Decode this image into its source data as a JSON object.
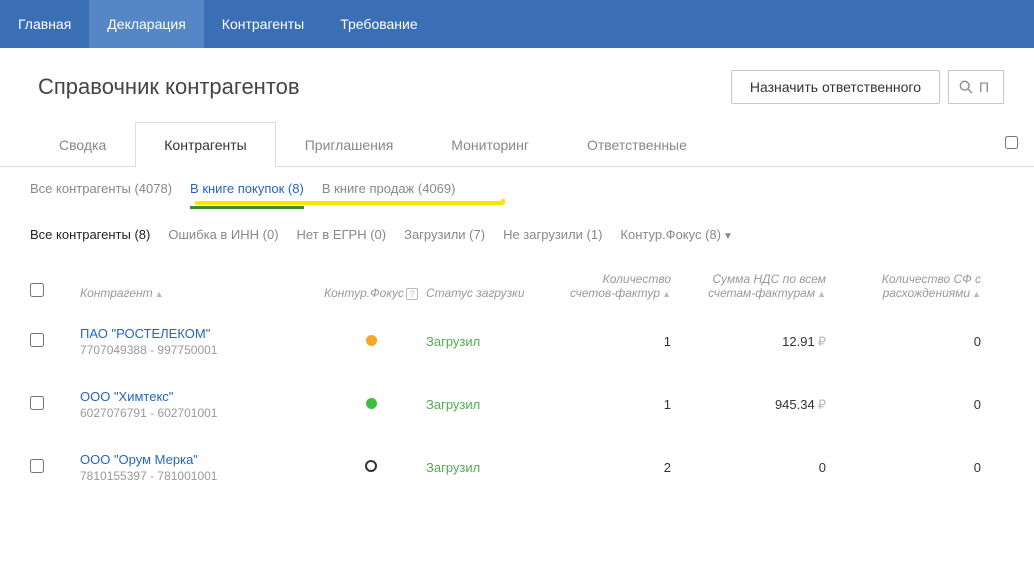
{
  "topnav": [
    {
      "label": "Главная",
      "active": false
    },
    {
      "label": "Декларация",
      "active": true
    },
    {
      "label": "Контрагенты",
      "active": false
    },
    {
      "label": "Требование",
      "active": false
    }
  ],
  "page_title": "Справочник контрагентов",
  "header_button": "Назначить ответственного",
  "search_placeholder": "П",
  "tabs": [
    {
      "label": "Сводка",
      "active": false
    },
    {
      "label": "Контрагенты",
      "active": true
    },
    {
      "label": "Приглашения",
      "active": false
    },
    {
      "label": "Мониторинг",
      "active": false
    },
    {
      "label": "Ответственные",
      "active": false
    }
  ],
  "subtabs": [
    {
      "label": "Все контрагенты (4078)",
      "selected": false
    },
    {
      "label": "В книге покупок (8)",
      "selected": true
    },
    {
      "label": "В книге продаж (4069)",
      "selected": false
    }
  ],
  "filters": [
    {
      "label": "Все контрагенты (8)",
      "active": true
    },
    {
      "label": "Ошибка в ИНН (0)",
      "active": false
    },
    {
      "label": "Нет в ЕГРН (0)",
      "active": false
    },
    {
      "label": "Загрузили (7)",
      "active": false
    },
    {
      "label": "Не загрузили (1)",
      "active": false
    },
    {
      "label": "Контур.Фокус (8)",
      "active": false,
      "dropdown": true
    }
  ],
  "columns": {
    "name": "Контрагент",
    "focus": "Контур.Фокус",
    "status": "Статус загрузки",
    "cnt": "Количество счетов-фактур",
    "sum": "Сумма НДС по всем счетам-фактурам",
    "disc": "Количество СФ с расхождениями"
  },
  "rows": [
    {
      "name": "ПАО \"РОСТЕЛЕКОМ\"",
      "sub": "7707049388 - 997750001",
      "dot": "orange",
      "status": "Загрузил",
      "cnt": "1",
      "sum": "12.91",
      "disc": "0"
    },
    {
      "name": "ООО \"Химтекс\"",
      "sub": "6027076791 - 602701001",
      "dot": "green",
      "status": "Загрузил",
      "cnt": "1",
      "sum": "945.34",
      "disc": "0"
    },
    {
      "name": "ООО \"Орум Мерка\"",
      "sub": "7810155397 - 781001001",
      "dot": "empty",
      "status": "Загрузил",
      "cnt": "2",
      "sum": "0",
      "disc": "0"
    }
  ]
}
